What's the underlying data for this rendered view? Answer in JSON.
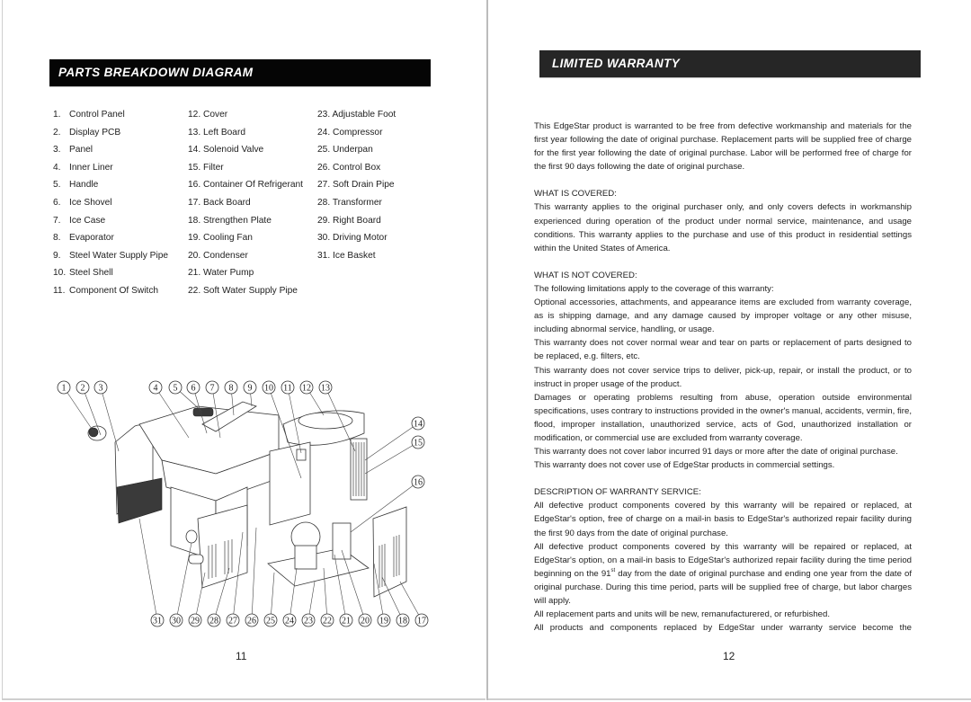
{
  "left_page": {
    "banner_title": "PARTS BREAKDOWN DIAGRAM",
    "page_number": "11",
    "parts": [
      {
        "num": "1.",
        "name": "Control Panel"
      },
      {
        "num": "2.",
        "name": "Display PCB"
      },
      {
        "num": "3.",
        "name": "Panel"
      },
      {
        "num": "4.",
        "name": "Inner Liner"
      },
      {
        "num": "5.",
        "name": "Handle"
      },
      {
        "num": "6.",
        "name": "Ice Shovel"
      },
      {
        "num": "7.",
        "name": "Ice Case"
      },
      {
        "num": "8.",
        "name": "Evaporator"
      },
      {
        "num": "9.",
        "name": "Steel Water Supply Pipe"
      },
      {
        "num": "10.",
        "name": "Steel Shell"
      },
      {
        "num": "11.",
        "name": "Component Of Switch"
      },
      {
        "num": "12.",
        "name": "Cover"
      },
      {
        "num": "13.",
        "name": "Left Board"
      },
      {
        "num": "14.",
        "name": "Solenoid Valve"
      },
      {
        "num": "15.",
        "name": "Filter"
      },
      {
        "num": "16.",
        "name": "Container Of Refrigerant"
      },
      {
        "num": "17.",
        "name": "Back Board"
      },
      {
        "num": "18.",
        "name": "Strengthen Plate"
      },
      {
        "num": "19.",
        "name": "Cooling Fan"
      },
      {
        "num": "20.",
        "name": "Condenser"
      },
      {
        "num": "21.",
        "name": "Water Pump"
      },
      {
        "num": "22.",
        "name": "Soft Water Supply Pipe"
      },
      {
        "num": "23.",
        "name": "Adjustable Foot"
      },
      {
        "num": "24.",
        "name": "Compressor"
      },
      {
        "num": "25.",
        "name": "Underpan"
      },
      {
        "num": "26.",
        "name": "Control Box"
      },
      {
        "num": "27.",
        "name": "Soft Drain Pipe"
      },
      {
        "num": "28.",
        "name": "Transformer"
      },
      {
        "num": "29.",
        "name": "Right Board"
      },
      {
        "num": "30.",
        "name": "Driving Motor"
      },
      {
        "num": "31.",
        "name": "Ice Basket"
      }
    ],
    "diagram": {
      "callouts_top": [
        "1",
        "2",
        "3",
        "4",
        "5",
        "6",
        "7",
        "8",
        "9",
        "10",
        "11",
        "12",
        "13"
      ],
      "callouts_right": [
        "14",
        "15",
        "16"
      ],
      "callouts_bottom": [
        "31",
        "30",
        "29",
        "28",
        "27",
        "26",
        "25",
        "24",
        "23",
        "22",
        "21",
        "20",
        "19",
        "18",
        "17"
      ]
    }
  },
  "right_page": {
    "banner_title": "LIMITED WARRANTY",
    "page_number": "12",
    "intro": "This EdgeStar product is warranted to be free from defective workmanship and materials for the first year following the date of original purchase. Replacement parts will be supplied free of charge for the first year following the date of original purchase. Labor will be performed free of charge for the first 90 days following the date of original purchase.",
    "covered": {
      "heading": "WHAT IS COVERED:",
      "text": "This warranty applies to the original purchaser only, and only covers defects in workmanship experienced during operation of the product under normal service, maintenance, and usage conditions. This warranty applies to the purchase and use of this product in residential settings within the United States of America."
    },
    "not_covered": {
      "heading": "WHAT IS NOT COVERED:",
      "lead": "The following limitations apply to the coverage of this warranty:",
      "items": [
        "Optional accessories, attachments, and appearance items are excluded from warranty coverage, as is shipping damage, and any damage caused by improper voltage or any other misuse, including abnormal service, handling, or usage.",
        "This warranty does not cover normal wear and tear on parts or replacement of parts designed to be replaced, e.g. filters, etc.",
        "This warranty does not cover service trips to deliver, pick-up, repair, or install the product, or to instruct in proper usage of the product.",
        "Damages or operating problems resulting from abuse, operation outside environmental specifications, uses contrary to instructions provided in the owner's manual, accidents, vermin, fire, flood, improper installation, unauthorized service, acts of God, unauthorized installation or modification, or commercial use are excluded from warranty coverage.",
        "This warranty does not cover labor incurred 91 days or more after the date of original purchase.",
        "This warranty does not cover use of EdgeStar products in commercial settings."
      ]
    },
    "service": {
      "heading": "DESCRIPTION OF WARRANTY SERVICE:",
      "item1": "All defective product components covered by this warranty will be repaired or replaced, at EdgeStar's option, free of charge on a mail-in basis to EdgeStar's authorized repair facility during the first 90 days from the date of original purchase.",
      "item2_before": "All defective product components covered by this warranty will be repaired or replaced, at EdgeStar's option, on a mail-in basis to EdgeStar's authorized repair facility during the time period beginning on the 91",
      "item2_sup": "st",
      "item2_after": " day from the date of original purchase and ending one year from the date of original purchase. During this time period, parts will be supplied free of charge, but labor charges will apply.",
      "item3": "All replacement parts and units will be new, remanufacturered, or refurbished.",
      "item4": "All products and components replaced by EdgeStar under warranty service become the"
    }
  }
}
